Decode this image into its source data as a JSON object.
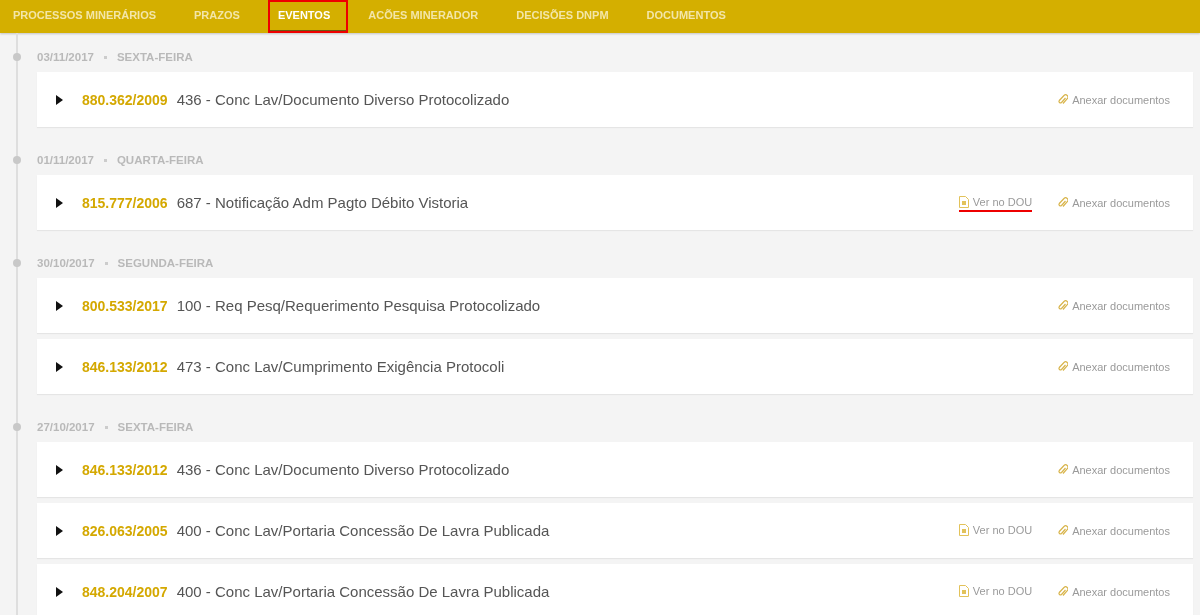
{
  "tabs": [
    {
      "label": "PROCESSOS MINERÁRIOS",
      "selected": false,
      "annotated": false
    },
    {
      "label": "PRAZOS",
      "selected": false,
      "annotated": false
    },
    {
      "label": "EVENTOS",
      "selected": true,
      "annotated": true
    },
    {
      "label": "ACÕES MINERADOR",
      "selected": false,
      "annotated": false
    },
    {
      "label": "DECISÕES DNPM",
      "selected": false,
      "annotated": false
    },
    {
      "label": "DOCUMENTOS",
      "selected": false,
      "annotated": false
    }
  ],
  "days": [
    {
      "date": "03/11/2017",
      "weekday": "SEXTA-FEIRA",
      "events": [
        {
          "process": "880.362/2009",
          "title": "436 - Conc Lav/Documento Diverso Protocolizado",
          "attach_link": "Anexar documentos"
        }
      ]
    },
    {
      "date": "01/11/2017",
      "weekday": "QUARTA-FEIRA",
      "events": [
        {
          "process": "815.777/2006",
          "title": "687 - Notificação Adm Pagto Débito Vistoria",
          "dou_link": {
            "label": "Ver no DOU",
            "annotated": true
          },
          "attach_link": "Anexar documentos"
        }
      ]
    },
    {
      "date": "30/10/2017",
      "weekday": "SEGUNDA-FEIRA",
      "events": [
        {
          "process": "800.533/2017",
          "title": "100 - Req Pesq/Requerimento Pesquisa Protocolizado",
          "attach_link": "Anexar documentos"
        },
        {
          "process": "846.133/2012",
          "title": "473 - Conc Lav/Cumprimento Exigência Protocoli",
          "attach_link": "Anexar documentos"
        }
      ]
    },
    {
      "date": "27/10/2017",
      "weekday": "SEXTA-FEIRA",
      "events": [
        {
          "process": "846.133/2012",
          "title": "436 - Conc Lav/Documento Diverso Protocolizado",
          "attach_link": "Anexar documentos"
        },
        {
          "process": "826.063/2005",
          "title": "400 - Conc Lav/Portaria Concessão De Lavra Publicada",
          "dou_link": {
            "label": "Ver no DOU",
            "annotated": false
          },
          "attach_link": "Anexar documentos"
        },
        {
          "process": "848.204/2007",
          "title": "400 - Conc Lav/Portaria Concessão De Lavra Publicada",
          "dou_link": {
            "label": "Ver no DOU",
            "annotated": false
          },
          "attach_link": "Anexar documentos"
        }
      ]
    }
  ]
}
